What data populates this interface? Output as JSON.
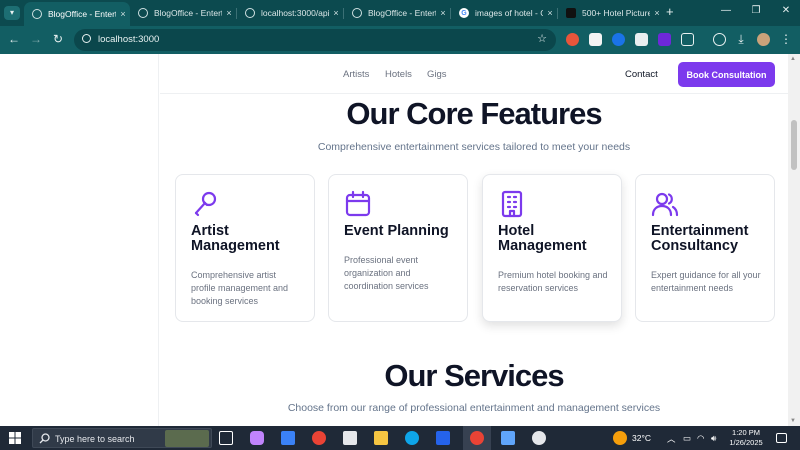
{
  "browser": {
    "tabs": [
      {
        "title": "BlogOffice - Entert",
        "active": true
      },
      {
        "title": "BlogOffice - Entert",
        "active": false
      },
      {
        "title": "localhost:3000/api",
        "active": false
      },
      {
        "title": "BlogOffice - Entert",
        "active": false
      },
      {
        "title": "images of hotel - G",
        "active": false
      },
      {
        "title": "500+ Hotel Picture",
        "active": false
      }
    ],
    "tab_close": "×",
    "new_tab": "+",
    "url": "localhost:3000",
    "window_controls": {
      "minimize": "—",
      "restore": "❐",
      "close": "✕"
    }
  },
  "site": {
    "nav_links": [
      "Artists",
      "Hotels",
      "Gigs"
    ],
    "contact": "Contact",
    "cta": "Book Consultation",
    "accent": "#7c3aed"
  },
  "features": {
    "title": "Our Core Features",
    "subtitle": "Comprehensive entertainment services tailored to meet your needs",
    "cards": [
      {
        "icon": "microphone-icon",
        "title": "Artist Management",
        "desc": "Comprehensive artist profile management and booking services"
      },
      {
        "icon": "calendar-icon",
        "title": "Event Planning",
        "desc": "Professional event organization and coordination services"
      },
      {
        "icon": "building-icon",
        "title": "Hotel Management",
        "desc": "Premium hotel booking and reservation services"
      },
      {
        "icon": "users-icon",
        "title": "Entertainment Consultancy",
        "desc": "Expert guidance for all your entertainment needs"
      }
    ]
  },
  "services": {
    "title": "Our Services",
    "subtitle": "Choose from our range of professional entertainment and management services"
  },
  "taskbar": {
    "search_placeholder": "Type here to search",
    "temperature": "32°C",
    "time": "1:20 PM",
    "date": "1/26/2025"
  }
}
